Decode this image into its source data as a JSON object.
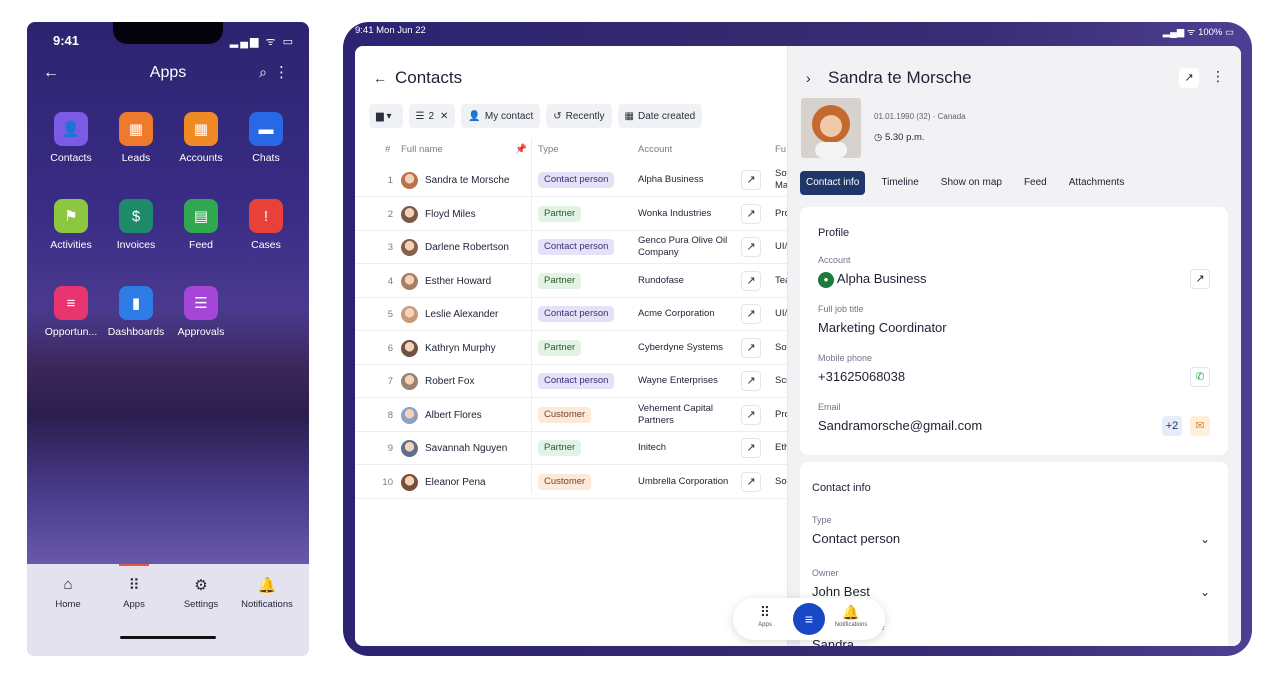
{
  "phone": {
    "status_time": "9:41",
    "status_icons": "▂▄▆ ᯤ ▭",
    "title": "Apps",
    "apps": [
      {
        "label": "Contacts",
        "icon": "contacts-icon",
        "color": "#7c5ae6",
        "glyph": "👤"
      },
      {
        "label": "Leads",
        "icon": "leads-icon",
        "color": "#f07a2c",
        "glyph": "▦"
      },
      {
        "label": "Accounts",
        "icon": "accounts-icon",
        "color": "#f08a24",
        "glyph": "▦"
      },
      {
        "label": "Chats",
        "icon": "chats-icon",
        "color": "#2668e6",
        "glyph": "▬"
      },
      {
        "label": "Activities",
        "icon": "activities-icon",
        "color": "#8dc63f",
        "glyph": "⚑"
      },
      {
        "label": "Invoices",
        "icon": "invoices-icon",
        "color": "#1e8a6a",
        "glyph": "$"
      },
      {
        "label": "Feed",
        "icon": "feed-icon",
        "color": "#2fa84f",
        "glyph": "▤"
      },
      {
        "label": "Cases",
        "icon": "cases-icon",
        "color": "#e8413a",
        "glyph": "!"
      },
      {
        "label": "Opportun...",
        "icon": "opportunities-icon",
        "color": "#e8356f",
        "glyph": "≡"
      },
      {
        "label": "Dashboards",
        "icon": "dashboards-icon",
        "color": "#2e7de6",
        "glyph": "▮"
      },
      {
        "label": "Approvals",
        "icon": "approvals-icon",
        "color": "#a546d8",
        "glyph": "☰"
      }
    ],
    "tabs": [
      {
        "label": "Home",
        "glyph": "⌂"
      },
      {
        "label": "Apps",
        "glyph": "⠿"
      },
      {
        "label": "Settings",
        "glyph": "⚙"
      },
      {
        "label": "Notifications",
        "glyph": "🔔"
      }
    ]
  },
  "tablet": {
    "status_time": "9:41  Mon Jun 22",
    "status_right": "▂▄▆ ᯤ 100% ▭",
    "list": {
      "title": "Contacts",
      "filters": [
        {
          "label": "",
          "icon": "folder-icon",
          "glyph": "▆ ▾"
        },
        {
          "label": "2",
          "icon": "filter-icon",
          "glyph": "☰",
          "suffix": "✕"
        },
        {
          "label": "My contact",
          "icon": "person-icon",
          "glyph": "👤"
        },
        {
          "label": "Recently",
          "icon": "history-icon",
          "glyph": "↺"
        },
        {
          "label": "Date created",
          "icon": "calendar-icon",
          "glyph": "▦"
        }
      ],
      "headers": {
        "num": "#",
        "name": "Full name",
        "type": "Type",
        "account": "Account",
        "full": "Fu"
      },
      "rows": [
        {
          "n": "1",
          "name": "Sandra te Morsche",
          "type": "Contact person",
          "account": "Alpha Business",
          "fu": "Sof Ma"
        },
        {
          "n": "2",
          "name": "Floyd Miles",
          "type": "Partner",
          "account": "Wonka Industries",
          "fu": "Pro"
        },
        {
          "n": "3",
          "name": "Darlene Robertson",
          "type": "Contact person",
          "account": "Genco Pura Olive Oil Company",
          "fu": "UI/"
        },
        {
          "n": "4",
          "name": "Esther Howard",
          "type": "Partner",
          "account": "Rundofase",
          "fu": "Tea"
        },
        {
          "n": "5",
          "name": "Leslie Alexander",
          "type": "Contact person",
          "account": "Acme Corporation",
          "fu": "UI/"
        },
        {
          "n": "6",
          "name": "Kathryn Murphy",
          "type": "Partner",
          "account": "Cyberdyne Systems",
          "fu": "Sof"
        },
        {
          "n": "7",
          "name": "Robert Fox",
          "type": "Contact person",
          "account": "Wayne Enterprises",
          "fu": "Scr"
        },
        {
          "n": "8",
          "name": "Albert Flores",
          "type": "Customer",
          "account": "Vehement Capital Partners",
          "fu": "Pro"
        },
        {
          "n": "9",
          "name": "Savannah Nguyen",
          "type": "Partner",
          "account": "Initech",
          "fu": "Eth"
        },
        {
          "n": "10",
          "name": "Eleanor Pena",
          "type": "Customer",
          "account": "Umbrella Corporation",
          "fu": "Sof"
        }
      ],
      "type_colors": {
        "Contact person": {
          "bg": "#e6e1f7",
          "fg": "#3a2f7a"
        },
        "Partner": {
          "bg": "#e2f3e4",
          "fg": "#245a30"
        },
        "Customer": {
          "bg": "#fde9da",
          "fg": "#7a4420"
        }
      }
    },
    "detail": {
      "name": "Sandra te Morsche",
      "dob": "01.01.1990 (32) · Canada",
      "local_time": "5.30 p.m.",
      "tabs": [
        "Contact info",
        "Timeline",
        "Show on map",
        "Feed",
        "Attachments"
      ],
      "profile": {
        "title": "Profile",
        "account_label": "Account",
        "account_value": "Alpha Business",
        "job_label": "Full job title",
        "job_value": "Marketing Coordinator",
        "mobile_label": "Mobile phone",
        "mobile_value": "+31625068038",
        "email_label": "Email",
        "email_value": "Sandramorsche@gmail.com",
        "email_extra": "+2"
      },
      "contact_info": {
        "title": "Contact info",
        "type_label": "Type",
        "type_value": "Contact person",
        "owner_label": "Owner",
        "owner_value": "John Best",
        "partial_label": "me",
        "partial_value": "Sandra"
      }
    },
    "floating_bar": {
      "apps_label": "Apps",
      "notifications_label": "Notifications"
    }
  }
}
